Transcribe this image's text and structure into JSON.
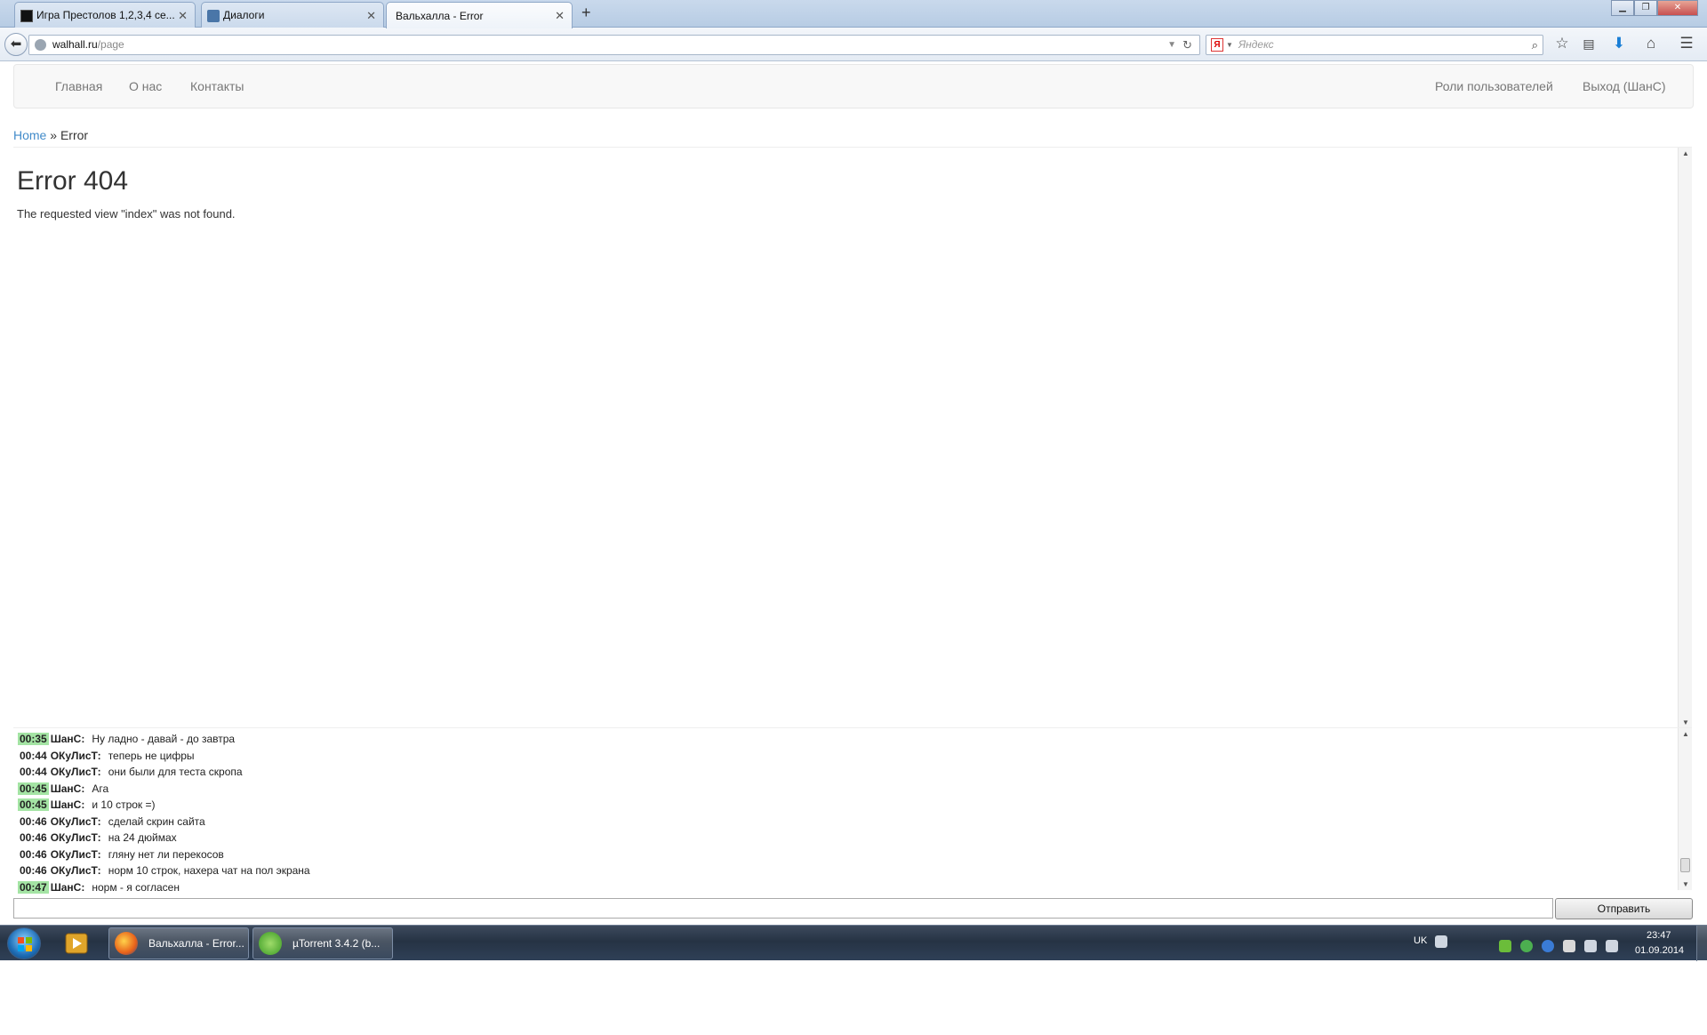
{
  "browser": {
    "tabs": [
      {
        "label": "Игра Престолов 1,2,3,4 се...",
        "close": "✕"
      },
      {
        "label": "Диалоги",
        "close": "✕"
      },
      {
        "label": "Вальхалла - Error",
        "close": "✕"
      }
    ],
    "new_tab": "+",
    "window_controls": {
      "minimize": "▁",
      "maximize": "❐",
      "close": "✕"
    },
    "url_host": "walhall.ru",
    "url_path": "/page",
    "search_placeholder": "Яндекс",
    "search_engine_letter": "Я"
  },
  "site_nav": {
    "left": [
      "Главная",
      "О нас",
      "Контакты"
    ],
    "right": [
      "Роли пользователей",
      "Выход (ШанС)"
    ]
  },
  "breadcrumb": {
    "home": "Home",
    "separator": "»",
    "current": "Error"
  },
  "error": {
    "title": "Error 404",
    "message": "The requested view \"index\" was not found."
  },
  "chat": {
    "messages": [
      {
        "time": "00:35",
        "user": "ШанС:",
        "text": "Ну ладно - давай - до завтра",
        "highlight": true
      },
      {
        "time": "00:44",
        "user": "ОКуЛисТ:",
        "text": "теперь не цифры",
        "highlight": false
      },
      {
        "time": "00:44",
        "user": "ОКуЛисТ:",
        "text": "они были для теста скропа",
        "highlight": false
      },
      {
        "time": "00:45",
        "user": "ШанС:",
        "text": "Ага",
        "highlight": true
      },
      {
        "time": "00:45",
        "user": "ШанС:",
        "text": "и 10 строк =)",
        "highlight": true
      },
      {
        "time": "00:46",
        "user": "ОКуЛисТ:",
        "text": "сделай скрин сайта",
        "highlight": false
      },
      {
        "time": "00:46",
        "user": "ОКуЛисТ:",
        "text": "на 24 дюймах",
        "highlight": false
      },
      {
        "time": "00:46",
        "user": "ОКуЛисТ:",
        "text": "гляну нет ли перекосов",
        "highlight": false
      },
      {
        "time": "00:46",
        "user": "ОКуЛисТ:",
        "text": "норм 10 строк, нахера чат на пол экрана",
        "highlight": false
      },
      {
        "time": "00:47",
        "user": "ШанС:",
        "text": "норм - я согласен",
        "highlight": true
      }
    ],
    "input_value": "",
    "send_label": "Отправить"
  },
  "taskbar": {
    "tasks": [
      "Вальхалла - Error...",
      "µTorrent 3.4.2  (b..."
    ],
    "language": "UK",
    "time": "23:47",
    "date": "01.09.2014"
  },
  "colors": {
    "chat_time_highlight": "#a4e4a4",
    "link": "#428bca",
    "nav_text": "#777777"
  }
}
